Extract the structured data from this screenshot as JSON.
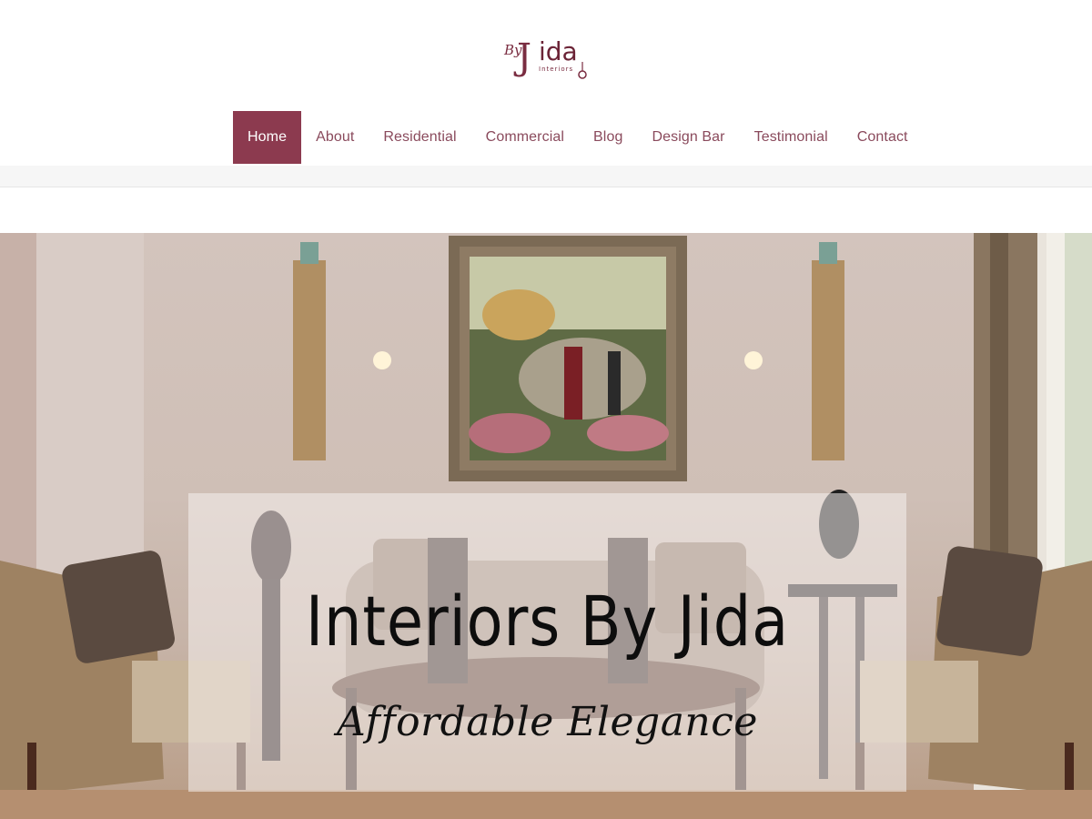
{
  "brand": {
    "logo_by": "By",
    "logo_name": "Jida",
    "logo_sub": "Interiors",
    "accent": "#8c3a4f"
  },
  "nav": {
    "items": [
      {
        "label": "Home",
        "active": true
      },
      {
        "label": "About"
      },
      {
        "label": "Residential"
      },
      {
        "label": "Commercial"
      },
      {
        "label": "Blog"
      },
      {
        "label": "Design Bar"
      },
      {
        "label": "Testimonial"
      },
      {
        "label": "Contact"
      }
    ]
  },
  "hero": {
    "title": "Interiors By Jida",
    "tagline": "Affordable Elegance"
  },
  "colors": {
    "nav_text": "#8a4a5c",
    "nav_active_bg": "#8c3a4f"
  }
}
